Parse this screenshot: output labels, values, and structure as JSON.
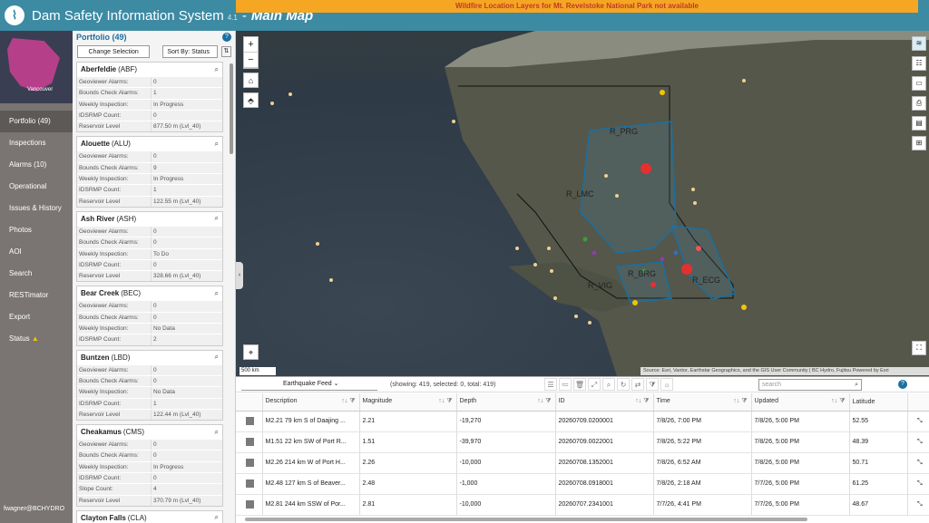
{
  "app": {
    "title": "Dam Safety Information System",
    "version": "4.1",
    "separator": "-",
    "page": "Main Map",
    "warning": "Wildfire Location Layers for Mt. Revelstoke National Park not available"
  },
  "nav": {
    "thumb_label": "Vancouver",
    "items": [
      "Portfolio (49)",
      "Inspections",
      "Alarms (10)",
      "Operational",
      "Issues & History",
      "Photos",
      "AOI",
      "Search",
      "RESTimator",
      "Export",
      "Status"
    ],
    "user": "fwagner@BCHYDRO"
  },
  "portfolio": {
    "title": "Portfolio (49)",
    "change_btn": "Change Selection",
    "sort_btn": "Sort By: Status",
    "cards": [
      {
        "name": "Aberfeldie",
        "code": "(ABF)",
        "rows": [
          [
            "Geoviewer Alarms:",
            "0"
          ],
          [
            "Bounds Check Alarms:",
            "1"
          ],
          [
            "Weekly Inspection:",
            "In Progress"
          ],
          [
            "IDSRMP Count:",
            "0"
          ],
          [
            "Reservoir Level",
            "877.50 m (Lvl_40)"
          ]
        ]
      },
      {
        "name": "Alouette",
        "code": "(ALU)",
        "rows": [
          [
            "Geoviewer Alarms:",
            "0"
          ],
          [
            "Bounds Check Alarms:",
            "9"
          ],
          [
            "Weekly Inspection:",
            "In Progress"
          ],
          [
            "IDSRMP Count:",
            "1"
          ],
          [
            "Reservoir Level",
            "122.55 m (Lvl_40)"
          ]
        ]
      },
      {
        "name": "Ash River",
        "code": "(ASH)",
        "rows": [
          [
            "Geoviewer Alarms:",
            "0"
          ],
          [
            "Bounds Check Alarms:",
            "0"
          ],
          [
            "Weekly Inspection:",
            "To Do"
          ],
          [
            "IDSRMP Count:",
            "0"
          ],
          [
            "Reservoir Level",
            "328.66 m (Lvl_40)"
          ]
        ]
      },
      {
        "name": "Bear Creek",
        "code": "(BEC)",
        "rows": [
          [
            "Geoviewer Alarms:",
            "0"
          ],
          [
            "Bounds Check Alarms:",
            "0"
          ],
          [
            "Weekly Inspection:",
            "No Data"
          ],
          [
            "IDSRMP Count:",
            "2"
          ]
        ]
      },
      {
        "name": "Buntzen",
        "code": "(LBD)",
        "rows": [
          [
            "Geoviewer Alarms:",
            "0"
          ],
          [
            "Bounds Check Alarms:",
            "0"
          ],
          [
            "Weekly Inspection:",
            "No Data"
          ],
          [
            "IDSRMP Count:",
            "1"
          ],
          [
            "Reservoir Level",
            "122.44 m (Lvl_40)"
          ]
        ]
      },
      {
        "name": "Cheakamus",
        "code": "(CMS)",
        "rows": [
          [
            "Geoviewer Alarms:",
            "0"
          ],
          [
            "Bounds Check Alarms:",
            "0"
          ],
          [
            "Weekly Inspection:",
            "In Progress"
          ],
          [
            "IDSRMP Count:",
            "0"
          ],
          [
            "Slope Count:",
            "4"
          ],
          [
            "Reservoir Level",
            "370.79 m (Lvl_40)"
          ]
        ]
      },
      {
        "name": "Clayton Falls",
        "code": "(CLA)",
        "rows": []
      }
    ]
  },
  "map": {
    "regions": [
      "R_PRG",
      "R_LMC",
      "R_BRG",
      "R_VIG",
      "R_ECG"
    ],
    "scale": "500 km",
    "attribution": "Source: Esri, Vantor, Earthstar Geographics, and the GIS User Community | BC Hydro, Fujitsu   Powered by Esri"
  },
  "grid": {
    "feed": "Earthquake Feed",
    "showing": "(showing: 419, selected: 0, total: 419)",
    "search_placeholder": "search",
    "columns": [
      "Description",
      "Magnitude",
      "Depth",
      "ID",
      "Time",
      "Updated",
      "Latitude"
    ],
    "rows": [
      [
        "M2.21 79 km S of Daajing ...",
        "2.21",
        "-19,270",
        "20260709.0200001",
        "7/8/26, 7:00 PM",
        "7/8/26, 5:00 PM",
        "52.55"
      ],
      [
        "M1.51 22 km SW of Port R...",
        "1.51",
        "-39,970",
        "20260709.0022001",
        "7/8/26, 5:22 PM",
        "7/8/26, 5:00 PM",
        "48.39"
      ],
      [
        "M2.26 214 km W of Port H...",
        "2.26",
        "-10,000",
        "20260708.1352001",
        "7/8/26, 6:52 AM",
        "7/8/26, 5:00 PM",
        "50.71"
      ],
      [
        "M2.48 127 km S of Beaver...",
        "2.48",
        "-1,000",
        "20260708.0918001",
        "7/8/26, 2:18 AM",
        "7/7/26, 5:00 PM",
        "61.25"
      ],
      [
        "M2.81 244 km SSW of Por...",
        "2.81",
        "-10,000",
        "20260707.2341001",
        "7/7/26, 4:41 PM",
        "7/7/26, 5:00 PM",
        "48.67"
      ]
    ]
  }
}
